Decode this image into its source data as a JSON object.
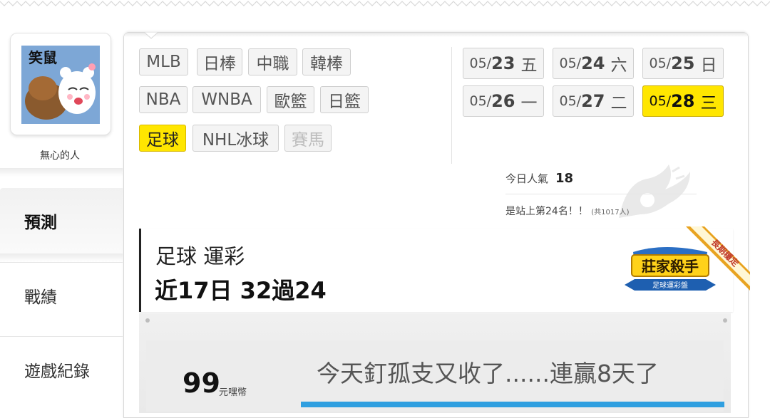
{
  "user": {
    "avatar_caption": "笑鼠",
    "name": "無心的人"
  },
  "sidebar": {
    "tabs": [
      {
        "label": "預測",
        "active": true
      },
      {
        "label": "戰績",
        "active": false
      },
      {
        "label": "遊戲紀錄",
        "active": false
      }
    ]
  },
  "sports": [
    {
      "label": "MLB",
      "state": "normal"
    },
    {
      "label": "日棒",
      "state": "normal"
    },
    {
      "label": "中職",
      "state": "normal"
    },
    {
      "label": "韓棒",
      "state": "normal"
    },
    {
      "label": "NBA",
      "state": "normal"
    },
    {
      "label": "WNBA",
      "state": "normal"
    },
    {
      "label": "歐籃",
      "state": "normal"
    },
    {
      "label": "日籃",
      "state": "normal"
    },
    {
      "label": "足球",
      "state": "active"
    },
    {
      "label": "NHL冰球",
      "state": "normal"
    },
    {
      "label": "賽馬",
      "state": "disabled"
    }
  ],
  "dates": [
    {
      "month": "05/",
      "day": "23",
      "weekday": "五",
      "active": false
    },
    {
      "month": "05/",
      "day": "24",
      "weekday": "六",
      "active": false
    },
    {
      "month": "05/",
      "day": "25",
      "weekday": "日",
      "active": false
    },
    {
      "month": "05/",
      "day": "26",
      "weekday": "一",
      "active": false
    },
    {
      "month": "05/",
      "day": "27",
      "weekday": "二",
      "active": false
    },
    {
      "month": "05/",
      "day": "28",
      "weekday": "三",
      "active": true
    }
  ],
  "popularity": {
    "label": "今日人氣",
    "value": "18",
    "rank_text": "是站上第24名！！",
    "total_text": "(共1017人)"
  },
  "record": {
    "title": "足球 運彩",
    "summary": "近17日 32過24",
    "badge_main": "莊家殺手",
    "badge_sub": "足球運彩盤",
    "badge_ribbon": "長期穩定"
  },
  "wallet": {
    "amount": "99",
    "unit": "元嘿幣"
  },
  "message": "今天釘孤支又收了......連贏8天了",
  "colors": {
    "active_yellow": "#ffe600",
    "accent_blue": "#2f9fe0",
    "badge_orange": "#e8a320"
  }
}
